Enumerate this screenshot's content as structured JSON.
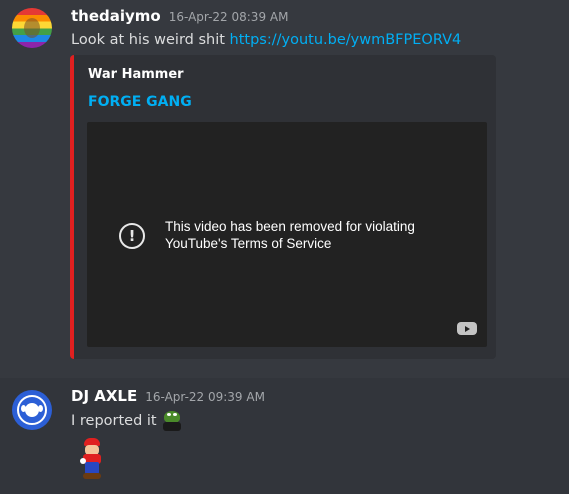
{
  "messages": [
    {
      "username": "thedaiymo",
      "timestamp": "16-Apr-22 08:39 AM",
      "text": "Look at his weird shit ",
      "link": "https://youtu.be/ywmBFPEORV4",
      "embed": {
        "author": "War Hammer",
        "title": "FORGE GANG",
        "accent_color": "#e02020",
        "video_status_icon": "exclamation-circle-icon",
        "video_status": "This video has been removed for violating YouTube's Terms of Service"
      }
    },
    {
      "username": "DJ AXLE",
      "timestamp": "16-Apr-22 09:39 AM",
      "text": "I reported it",
      "emoji": "frog-emoji",
      "sticker": "mario-sticker"
    }
  ],
  "colors": {
    "background": "#36393f",
    "link": "#00aff4",
    "embed_background": "#2f3136"
  }
}
